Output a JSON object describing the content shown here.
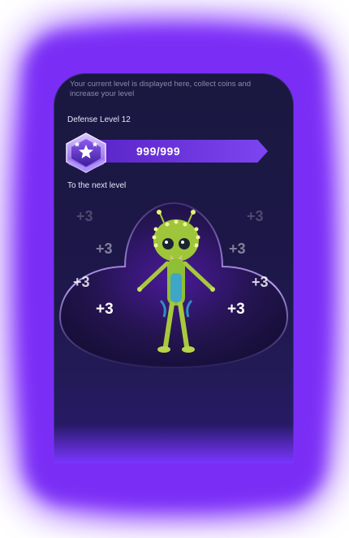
{
  "intro_text": "Your current level is displayed here, collect coins and increase your level",
  "level": {
    "title": "Defense Level 12",
    "progress_text": "999/999",
    "progress_fraction": 1.0,
    "badge_stars": 2
  },
  "next_level_label": "To the next level",
  "bonuses": [
    "+3",
    "+3",
    "+3",
    "+3",
    "+3",
    "+3",
    "+3",
    "+3"
  ],
  "character": "alien-character",
  "colors": {
    "accent": "#7b2cff",
    "panel": "#1c1747",
    "bar": "#5a2bc6"
  }
}
